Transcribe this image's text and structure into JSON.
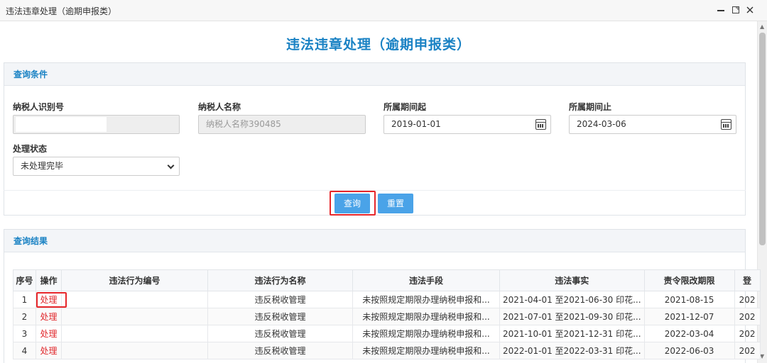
{
  "window": {
    "title": "违法违章处理（逾期申报类）",
    "min_icon": "minimize-icon",
    "max_icon": "maximize-icon",
    "close_icon": "close-icon"
  },
  "page": {
    "title": "违法违章处理（逾期申报类）"
  },
  "query_panel": {
    "header": "查询条件",
    "fields": {
      "taxpayer_id": {
        "label": "纳税人识别号",
        "value": ""
      },
      "taxpayer_name": {
        "label": "纳税人名称",
        "value": "纳税人名称390485"
      },
      "period_start": {
        "label": "所属期间起",
        "value": "2019-01-01"
      },
      "period_end": {
        "label": "所属期间止",
        "value": "2024-03-06"
      },
      "status": {
        "label": "处理状态",
        "value": "未处理完毕"
      }
    },
    "buttons": {
      "query": "查询",
      "reset": "重置"
    }
  },
  "result_panel": {
    "header": "查询结果",
    "columns": [
      "序号",
      "操作",
      "违法行为编号",
      "违法行为名称",
      "违法手段",
      "违法事实",
      "责令限改期限",
      "登"
    ],
    "rows": [
      [
        "1",
        "处理",
        "",
        "违反税收管理",
        "未按照规定期限办理纳税申报和...",
        "2021-04-01 至2021-06-30 印花...",
        "2021-08-15",
        "202"
      ],
      [
        "2",
        "处理",
        "",
        "违反税收管理",
        "未按照规定期限办理纳税申报和...",
        "2021-07-01 至2021-09-30 印花...",
        "2021-12-07",
        "202"
      ],
      [
        "3",
        "处理",
        "",
        "违反税收管理",
        "未按照规定期限办理纳税申报和...",
        "2021-10-01 至2021-12-31 印花...",
        "2022-03-04",
        "202"
      ],
      [
        "4",
        "处理",
        "",
        "违反税收管理",
        "未按照规定期限办理纳税申报和...",
        "2022-01-01 至2022-03-31 印花...",
        "2022-06-03",
        "202"
      ]
    ]
  },
  "colors": {
    "accent": "#1a82c4",
    "button": "#4aa3e8",
    "highlight": "#e6262a",
    "action_link": "#e0262a"
  }
}
